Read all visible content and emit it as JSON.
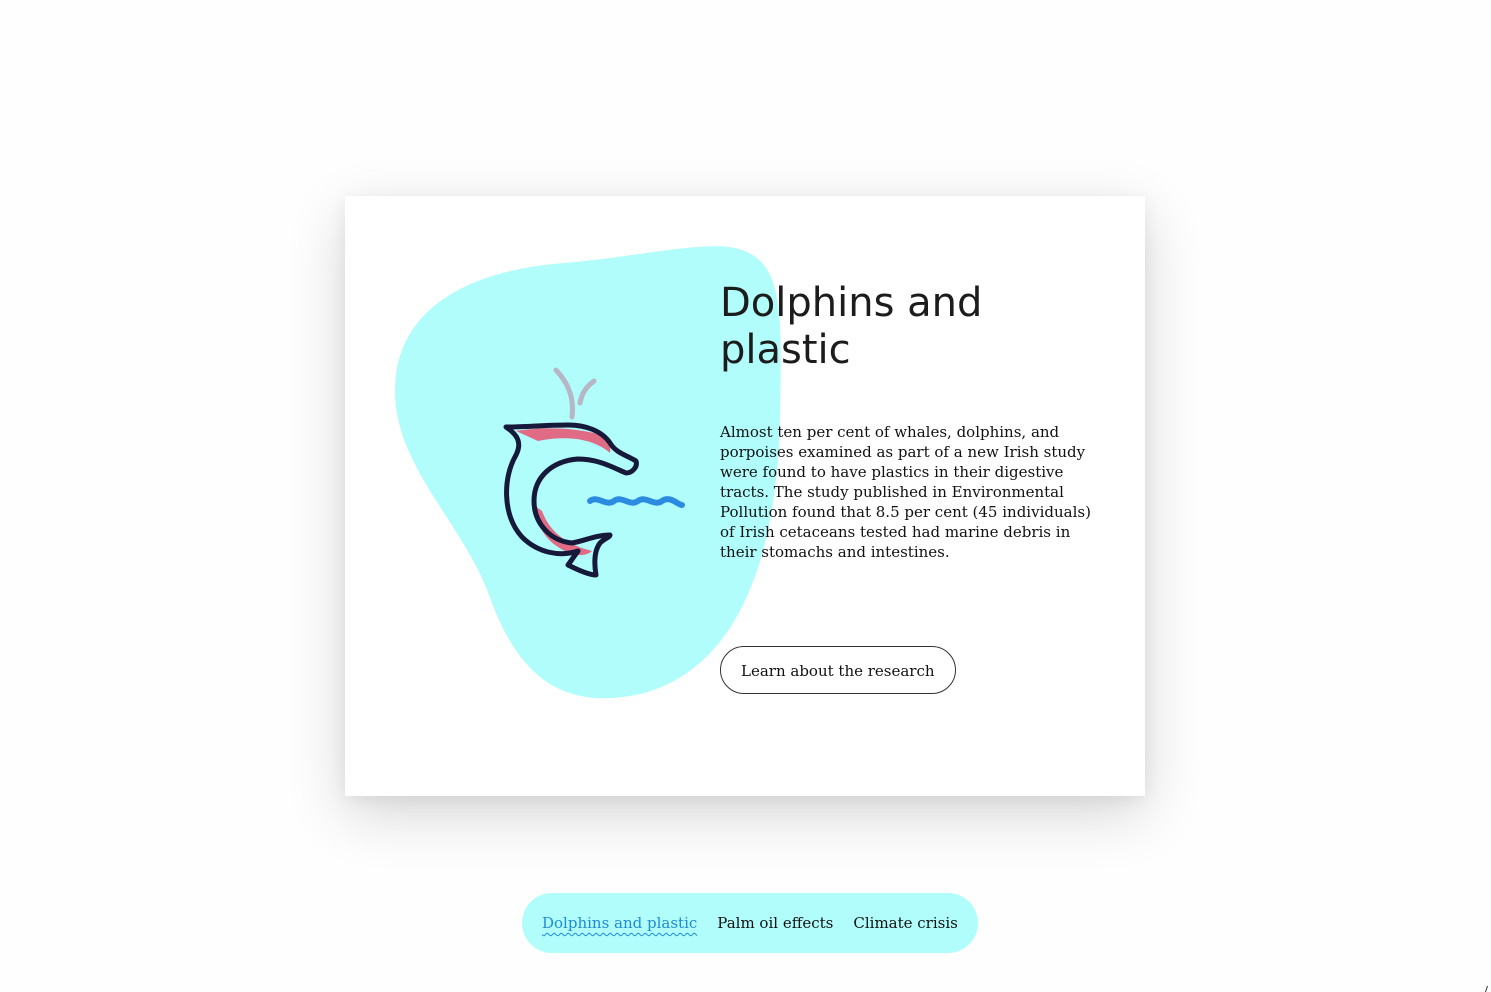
{
  "slide": {
    "title": "Dolphins and plastic",
    "body": "Almost ten per cent of whales, dolphins, and porpoises examined as part of a new Irish study were found to have plastics in their digestive tracts. The study published in Environmental Pollution found that 8.5 per cent (45 individuals) of Irish cetaceans tested had marine debris in their stomachs and intestines.",
    "cta_label": "Learn about the research",
    "illustration_icon": "dolphin-icon"
  },
  "nav": {
    "items": [
      {
        "label": "Dolphins and plastic",
        "active": true
      },
      {
        "label": "Palm oil effects",
        "active": false
      },
      {
        "label": "Climate crisis",
        "active": false
      }
    ]
  },
  "colors": {
    "blob": "#b0fdfc",
    "dolphin_outline": "#16193a",
    "dolphin_accent": "#e06b85",
    "spout": "#b6b6c4",
    "water": "#2b8be0",
    "active_link": "#1e8ad8"
  }
}
